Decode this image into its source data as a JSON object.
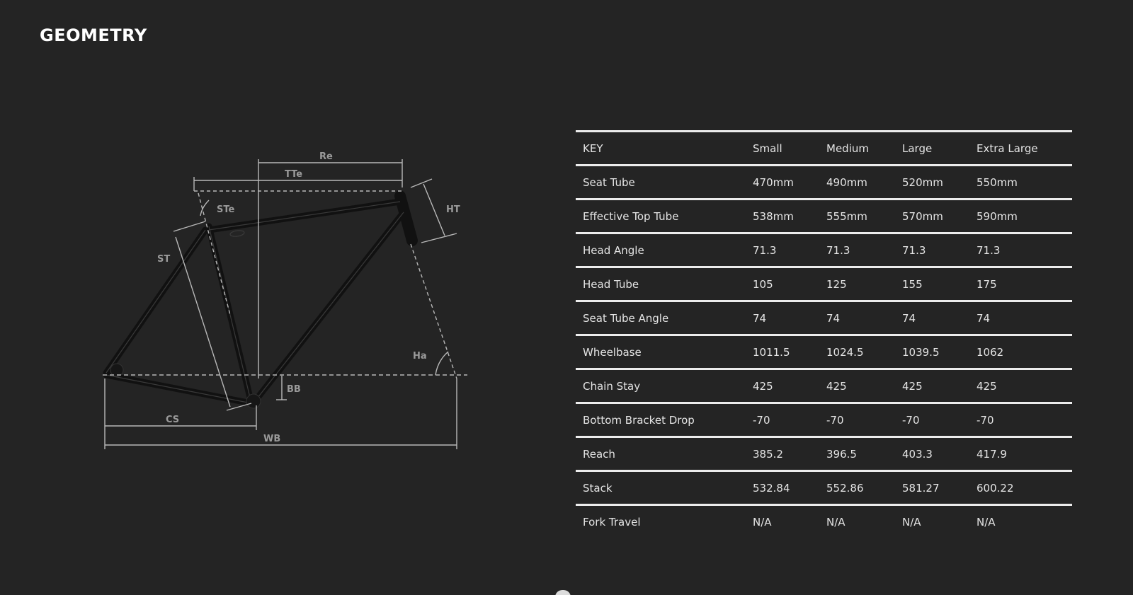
{
  "title": "GEOMETRY",
  "diagram": {
    "labels": {
      "re": "Re",
      "tte": "TTe",
      "ste": "STe",
      "ht": "HT",
      "st": "ST",
      "ha": "Ha",
      "bb": "BB",
      "cs": "CS",
      "wb": "WB"
    }
  },
  "table": {
    "header": [
      "KEY",
      "Small",
      "Medium",
      "Large",
      "Extra Large"
    ],
    "rows": [
      [
        "Seat Tube",
        "470mm",
        "490mm",
        "520mm",
        "550mm"
      ],
      [
        "Effective Top Tube",
        "538mm",
        "555mm",
        "570mm",
        "590mm"
      ],
      [
        "Head Angle",
        "71.3",
        "71.3",
        "71.3",
        "71.3"
      ],
      [
        "Head Tube",
        "105",
        "125",
        "155",
        "175"
      ],
      [
        "Seat Tube Angle",
        "74",
        "74",
        "74",
        "74"
      ],
      [
        "Wheelbase",
        "1011.5",
        "1024.5",
        "1039.5",
        "1062"
      ],
      [
        "Chain Stay",
        "425",
        "425",
        "425",
        "425"
      ],
      [
        "Bottom Bracket Drop",
        "-70",
        "-70",
        "-70",
        "-70"
      ],
      [
        "Reach",
        "385.2",
        "396.5",
        "403.3",
        "417.9"
      ],
      [
        "Stack",
        "532.84",
        "552.86",
        "581.27",
        "600.22"
      ],
      [
        "Fork Travel",
        "N/A",
        "N/A",
        "N/A",
        "N/A"
      ]
    ]
  }
}
